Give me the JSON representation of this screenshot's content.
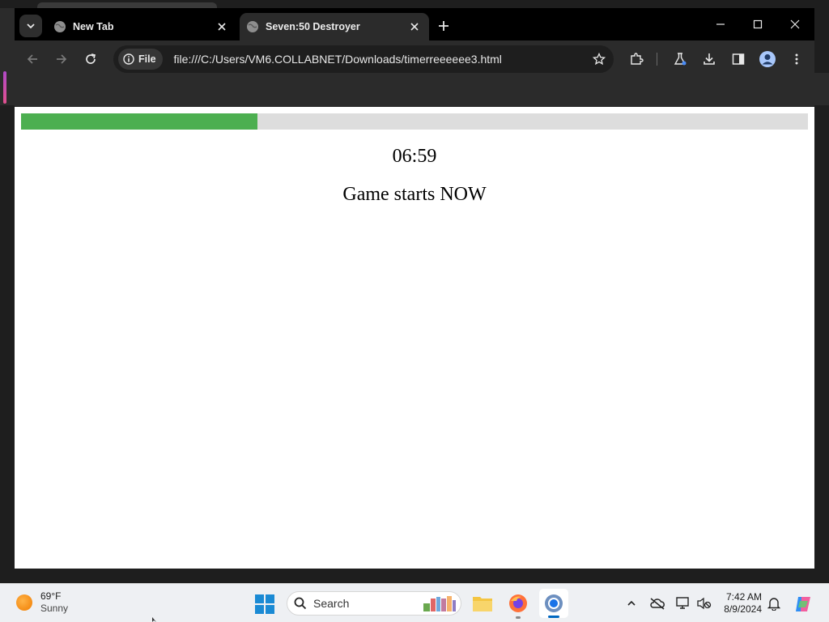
{
  "browser": {
    "tabs": [
      {
        "label": "New Tab",
        "active": false
      },
      {
        "label": "Seven:50 Destroyer",
        "active": true
      }
    ],
    "address_bar": {
      "chip_label": "File",
      "url": "file:///C:/Users/VM6.COLLABNET/Downloads/timerreeeeee3.html"
    }
  },
  "page": {
    "timer": "06:59",
    "message": "Game starts NOW",
    "progress_percent": 30,
    "colors": {
      "progress_fill": "#4caf50",
      "progress_track": "#dddddd"
    }
  },
  "taskbar": {
    "weather": {
      "temperature": "69°F",
      "condition": "Sunny"
    },
    "search_placeholder": "Search",
    "clock": {
      "time": "7:42 AM",
      "date": "8/9/2024"
    },
    "accent_color": "#0067c0"
  }
}
